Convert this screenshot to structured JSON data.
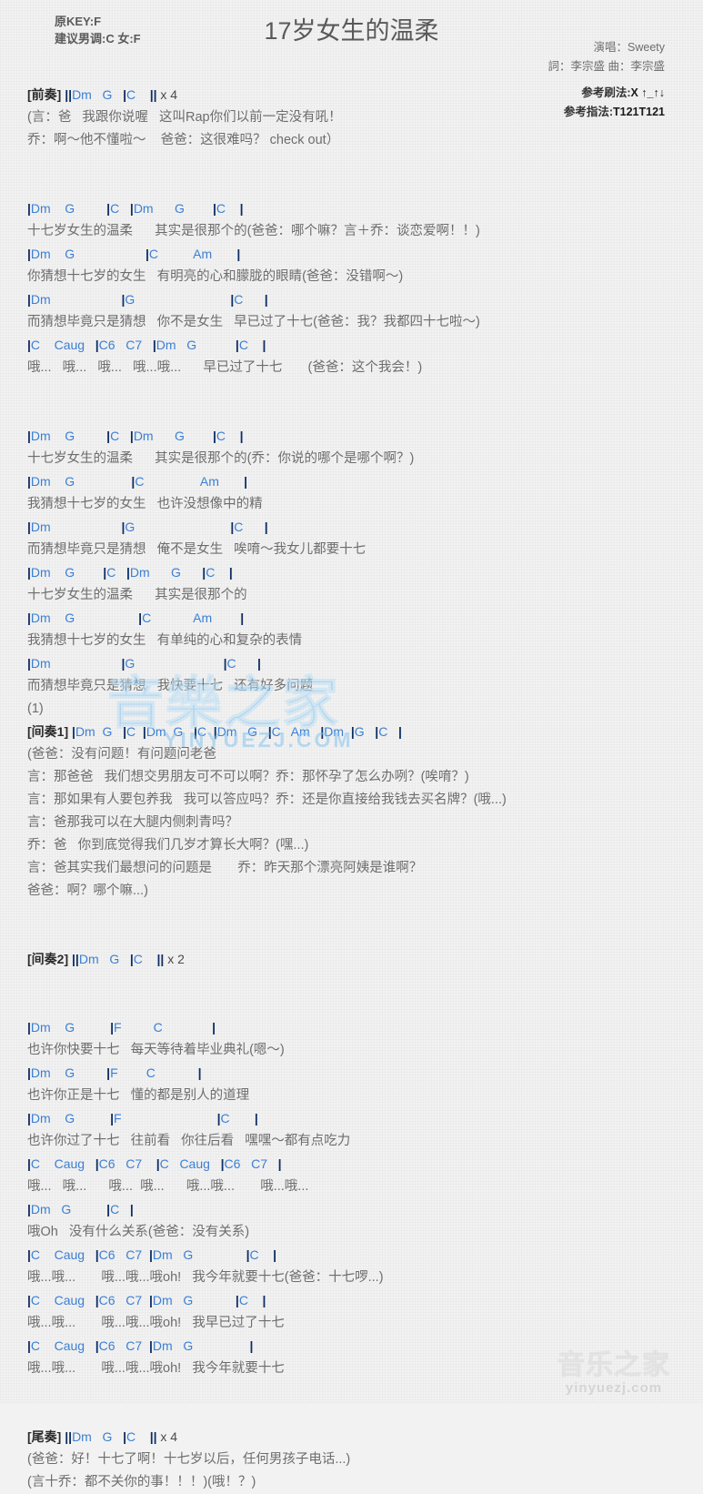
{
  "header": {
    "orig_key": "原KEY:F",
    "suggest_key": "建议男调:C 女:F",
    "title": "17岁女生的温柔",
    "singer": "演唱：Sweety",
    "writers": "詞：李宗盛  曲：李宗盛",
    "strum_label": "参考刷法:",
    "strum_value": "X ↑_↑↓",
    "fingering_label": "参考指法:",
    "fingering_value": "T121T121"
  },
  "colors": {
    "chord": "#3b7fd4",
    "barline": "#0d2d63",
    "lyric": "#6d6d6d",
    "section": "#2b2b2b",
    "watermark_blue": "#86c5ef",
    "watermark_gray": "#bdbdbd",
    "background": "#f2f2f2"
  },
  "watermarks": {
    "big_text": "音樂之家",
    "big_sub": "YINYUEZJ.COM",
    "small_text": "音乐之家",
    "small_sub": "yinyuezj.com"
  },
  "sections": [
    {
      "type": "intro_head",
      "section": "[前奏]",
      "chords": " ||Dm   G   |C    || x 4"
    },
    {
      "type": "lyric",
      "text": "(言：爸   我跟你说喔   这叫Rap你们以前一定没有吼！"
    },
    {
      "type": "lyric",
      "text": "乔：啊～他不懂啦～    爸爸：这很难吗？ check out）"
    },
    {
      "type": "spacer"
    },
    {
      "type": "spacer"
    },
    {
      "type": "chord",
      "text": "|Dm    G         |C   |Dm      G        |C    |"
    },
    {
      "type": "lyric",
      "text": "十七岁女生的温柔      其实是很那个的(爸爸：哪个嘛？言＋乔：谈恋爱啊！！)"
    },
    {
      "type": "chord",
      "text": "|Dm    G                    |C          Am       |"
    },
    {
      "type": "lyric",
      "text": "你猜想十七岁的女生   有明亮的心和朦胧的眼睛(爸爸：没错啊～)"
    },
    {
      "type": "chord",
      "text": "|Dm                    |G                           |C      |"
    },
    {
      "type": "lyric",
      "text": "而猜想毕竟只是猜想   你不是女生   早已过了十七(爸爸：我？我都四十七啦～)"
    },
    {
      "type": "chord",
      "text": "|C    Caug   |C6   C7   |Dm   G           |C    |"
    },
    {
      "type": "lyric",
      "text": "哦...   哦...   哦...   哦...哦...      早已过了十七       (爸爸：这个我会！)"
    },
    {
      "type": "spacer"
    },
    {
      "type": "spacer"
    },
    {
      "type": "chord",
      "text": "|Dm    G         |C   |Dm      G        |C    |"
    },
    {
      "type": "lyric",
      "text": "十七岁女生的温柔      其实是很那个的(乔：你说的哪个是哪个啊？)"
    },
    {
      "type": "chord",
      "text": "|Dm    G                |C                Am       |"
    },
    {
      "type": "lyric",
      "text": "我猜想十七岁的女生   也许没想像中的精"
    },
    {
      "type": "chord",
      "text": "|Dm                    |G                           |C      |"
    },
    {
      "type": "lyric",
      "text": "而猜想毕竟只是猜想   俺不是女生   唉唷～我女儿都要十七"
    },
    {
      "type": "chord",
      "text": "|Dm    G        |C   |Dm      G      |C    |"
    },
    {
      "type": "lyric",
      "text": "十七岁女生的温柔      其实是很那个的"
    },
    {
      "type": "chord",
      "text": "|Dm    G                  |C            Am        |"
    },
    {
      "type": "lyric",
      "text": "我猜想十七岁的女生   有单纯的心和复杂的表情"
    },
    {
      "type": "chord",
      "text": "|Dm                    |G                         |C      |"
    },
    {
      "type": "lyric",
      "text": "而猜想毕竟只是猜想   我快要十七   还有好多问题"
    },
    {
      "type": "lyric",
      "text": "(1)"
    },
    {
      "type": "section_chord",
      "section": "[间奏1]",
      "chords": " |Dm  G   |C  |Dm  G   |C  |Dm   G   |C   Am   |Dm  |G   |C   |"
    },
    {
      "type": "lyric",
      "text": "(爸爸：没有问题！有问题问老爸"
    },
    {
      "type": "lyric",
      "text": "言：那爸爸   我们想交男朋友可不可以啊？乔：那怀孕了怎么办咧？(唉唷？)"
    },
    {
      "type": "lyric",
      "text": "言：那如果有人要包养我   我可以答应吗？乔：还是你直接给我钱去买名牌？(哦...)"
    },
    {
      "type": "lyric",
      "text": "言：爸那我可以在大腿内侧刺青吗？"
    },
    {
      "type": "lyric",
      "text": "乔：爸   你到底觉得我们几岁才算长大啊？(嘿...)"
    },
    {
      "type": "lyric",
      "text": "言：爸其实我们最想问的问题是       乔：昨天那个漂亮阿姨是谁啊？"
    },
    {
      "type": "lyric",
      "text": "爸爸：啊？哪个嘛...)"
    },
    {
      "type": "spacer"
    },
    {
      "type": "spacer"
    },
    {
      "type": "section_chord",
      "section": "[间奏2]",
      "chords": " ||Dm   G   |C    || x 2"
    },
    {
      "type": "spacer"
    },
    {
      "type": "spacer"
    },
    {
      "type": "chord",
      "text": "|Dm    G          |F         C              |"
    },
    {
      "type": "lyric",
      "text": "也许你快要十七   每天等待着毕业典礼(嗯～)"
    },
    {
      "type": "chord",
      "text": "|Dm    G         |F        C            |"
    },
    {
      "type": "lyric",
      "text": "也许你正是十七   懂的都是别人的道理"
    },
    {
      "type": "chord",
      "text": "|Dm    G          |F                           |C       |"
    },
    {
      "type": "lyric",
      "text": "也许你过了十七   往前看   你往后看   嘿嘿～都有点吃力"
    },
    {
      "type": "chord",
      "text": "|C    Caug   |C6   C7    |C   Caug   |C6   C7   |"
    },
    {
      "type": "lyric",
      "text": "哦...   哦...      哦...  哦...      哦...哦...       哦...哦..."
    },
    {
      "type": "chord",
      "text": "|Dm   G          |C   |"
    },
    {
      "type": "lyric",
      "text": "哦Oh   没有什么关系(爸爸：没有关系)"
    },
    {
      "type": "chord",
      "text": "|C    Caug   |C6   C7  |Dm   G               |C    |"
    },
    {
      "type": "lyric",
      "text": "哦...哦...       哦...哦...哦oh!   我今年就要十七(爸爸：十七啰...)"
    },
    {
      "type": "chord",
      "text": "|C    Caug   |C6   C7  |Dm   G            |C    |"
    },
    {
      "type": "lyric",
      "text": "哦...哦...       哦...哦...哦oh!   我早已过了十七"
    },
    {
      "type": "chord",
      "text": "|C    Caug   |C6   C7  |Dm   G                |"
    },
    {
      "type": "lyric",
      "text": "哦...哦...       哦...哦...哦oh!   我今年就要十七"
    },
    {
      "type": "spacer"
    },
    {
      "type": "spacer"
    },
    {
      "type": "section_chord",
      "section": "[尾奏]",
      "chords": " ||Dm   G   |C    || x 4"
    },
    {
      "type": "lyric",
      "text": "(爸爸：好！十七了啊！十七岁以后，任何男孩子电话...)"
    },
    {
      "type": "lyric",
      "text": "(言十乔：都不关你的事！！！)(哦！？)"
    }
  ]
}
